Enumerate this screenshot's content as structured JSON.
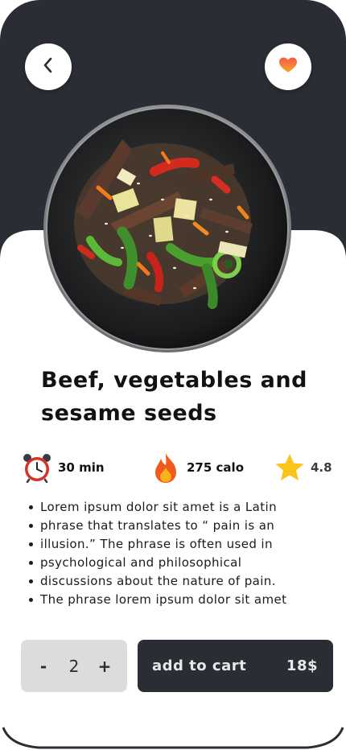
{
  "product": {
    "title_line1": "Beef, vegetables and",
    "title_line2": "sesame seeds"
  },
  "stats": {
    "time": "30 min",
    "time_icon": "alarm-clock-icon",
    "calories": "275 calo",
    "calories_icon": "fire-icon",
    "rating": "4.8",
    "rating_icon": "star-icon"
  },
  "description": [
    "Lorem ipsum dolor sit amet is a Latin",
    " phrase that translates to “ pain is an",
    " illusion.” The phrase is often used in",
    " psychological and philosophical",
    " discussions about the nature of pain.",
    " The phrase lorem ipsum dolor sit amet"
  ],
  "cart": {
    "minus": "-",
    "quantity": "2",
    "plus": "+",
    "add_label": "add to cart",
    "price": "18$"
  },
  "icons": {
    "back": "chevron-left-icon",
    "favorite": "heart-icon"
  },
  "colors": {
    "dark": "#2a2d33",
    "heart": "#f07a3a",
    "qty_bg": "#dcdcdc"
  }
}
